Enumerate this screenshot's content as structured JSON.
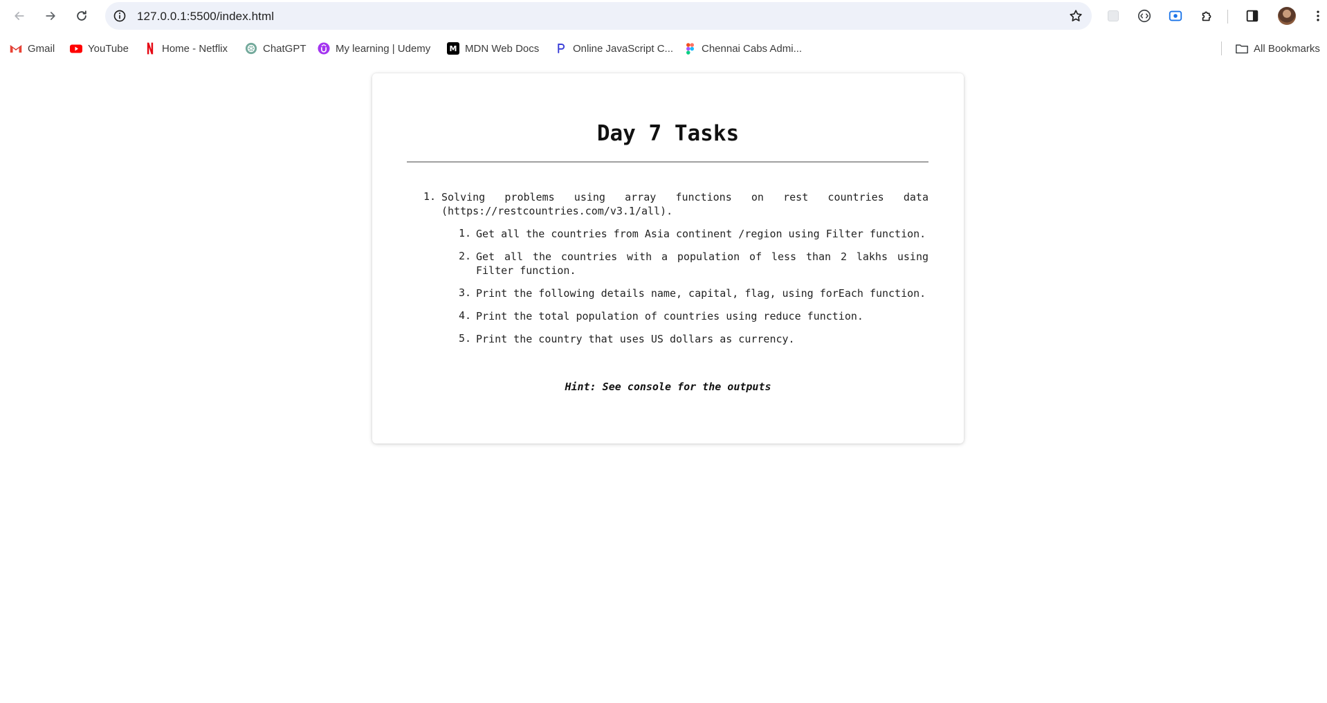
{
  "browser": {
    "url": "127.0.0.1:5500/index.html",
    "bookmarks": [
      {
        "label": "Gmail",
        "icon": "gmail-icon"
      },
      {
        "label": "YouTube",
        "icon": "youtube-icon"
      },
      {
        "label": "Home - Netflix",
        "icon": "netflix-icon"
      },
      {
        "label": "ChatGPT",
        "icon": "chatgpt-icon"
      },
      {
        "label": "My learning | Udemy",
        "icon": "udemy-icon"
      },
      {
        "label": "MDN Web Docs",
        "icon": "mdn-icon"
      },
      {
        "label": "Online JavaScript C...",
        "icon": "programiz-icon"
      },
      {
        "label": "Chennai Cabs Admi...",
        "icon": "figma-icon"
      }
    ],
    "all_bookmarks_label": "All Bookmarks",
    "colors": {
      "omnibox": "#eef1f9",
      "gmail": "#ea4335",
      "youtube": "#ff0000",
      "netflix": "#e50914",
      "chatgpt": "#74aa9c",
      "udemy": "#a435f0",
      "mdn": "#000000",
      "programiz": "#3b3fd8"
    }
  },
  "page": {
    "title": "Day 7 Tasks",
    "tasks": [
      {
        "number": "1.",
        "text": "Solving problems using array functions on rest countries data (https://restcountries.com/v3.1/all).",
        "subtasks": [
          {
            "number": "1.",
            "text": "Get all the countries from Asia continent /region using Filter function."
          },
          {
            "number": "2.",
            "text": "Get all the countries with a population of less than 2 lakhs using Filter function."
          },
          {
            "number": "3.",
            "text": "Print the following details name, capital, flag, using forEach function."
          },
          {
            "number": "4.",
            "text": "Print the total population of countries using reduce function."
          },
          {
            "number": "5.",
            "text": "Print the country that uses US dollars as currency."
          }
        ]
      }
    ],
    "hint": "Hint: See console for the outputs"
  }
}
